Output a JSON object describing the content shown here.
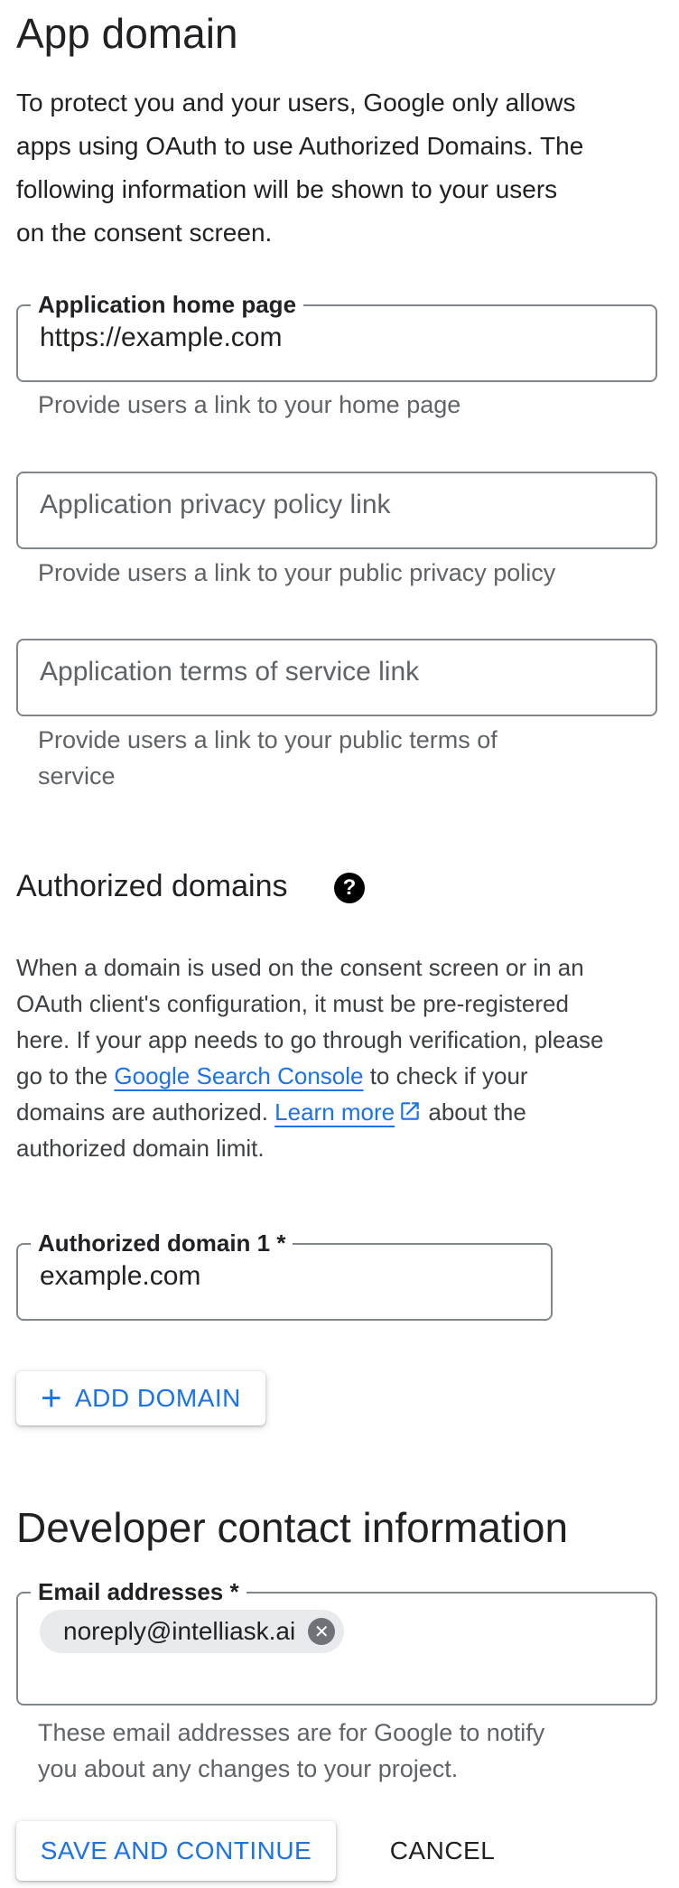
{
  "app_domain": {
    "title": "App domain",
    "description_lines": [
      "To protect you and your users, Google only allows",
      "apps using OAuth to use Authorized Domains. The",
      "following information will be shown to your users",
      "on the consent screen."
    ],
    "home_page": {
      "label": "Application home page",
      "value": "https://example.com",
      "hint": "Provide users a link to your home page"
    },
    "privacy_policy": {
      "placeholder": "Application privacy policy link",
      "hint": "Provide users a link to your public privacy policy"
    },
    "terms_of_service": {
      "placeholder": "Application terms of service link",
      "hint_lines": [
        "Provide users a link to your public terms of",
        "service"
      ]
    }
  },
  "authorized_domains": {
    "title": "Authorized domains",
    "help_icon": "help-circle-icon",
    "description": {
      "line1": "When a domain is used on the consent screen or in an",
      "line2": "OAuth client's configuration, it must be pre-registered",
      "line3": "here. If your app needs to go through verification, please",
      "line4_pre": "go to the ",
      "line4_link": "Google Search Console",
      "line4_post": " to check if your",
      "line5_pre": "domains are authorized. ",
      "line5_link": "Learn more",
      "line5_post": " about the",
      "line6": "authorized domain limit."
    },
    "domain_1": {
      "label": "Authorized domain 1 *",
      "value": "example.com"
    },
    "add_domain_label": "ADD DOMAIN"
  },
  "developer_contact": {
    "title": "Developer contact information",
    "email": {
      "label": "Email addresses *",
      "chips": [
        "noreply@intelliask.ai"
      ],
      "hint_lines": [
        "These email addresses are for Google to notify",
        "you about any changes to your project."
      ]
    }
  },
  "actions": {
    "save_label": "SAVE AND CONTINUE",
    "cancel_label": "CANCEL"
  },
  "colors": {
    "accent": "#1a73e8",
    "text": "#202124",
    "hint": "#5f6368",
    "border": "#80868b"
  }
}
